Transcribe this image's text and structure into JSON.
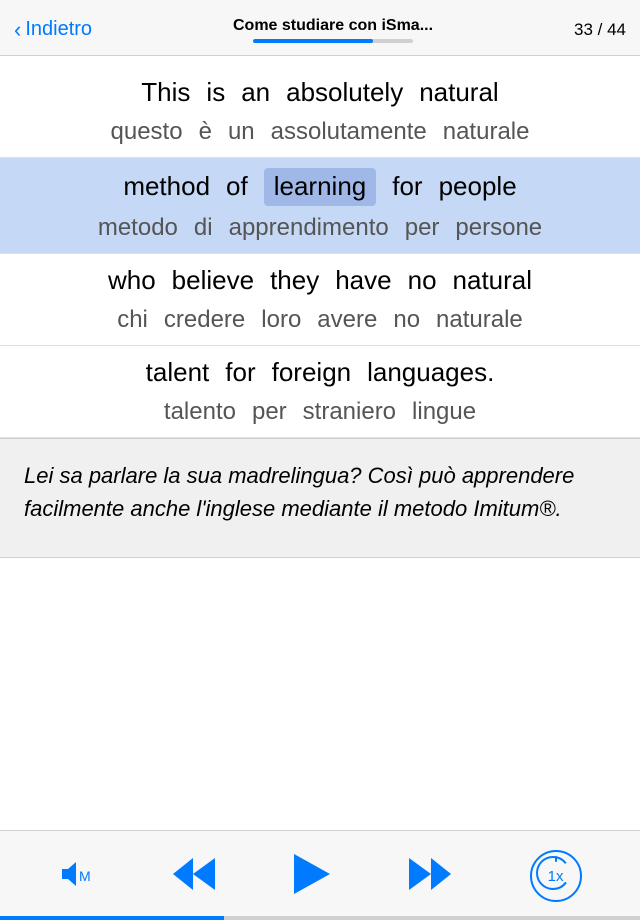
{
  "header": {
    "back_label": "Indietro",
    "title": "Come studiare con iSma...",
    "page_current": "33",
    "page_total": "44",
    "page_display": "33 / 44",
    "progress_percent": 75
  },
  "content": {
    "rows": [
      {
        "id": "row1",
        "highlighted": false,
        "english_words": [
          "This",
          "is",
          "an",
          "absolutely",
          "natural"
        ],
        "italian_words": [
          "questo",
          "è",
          "un",
          "assolutamente",
          "naturale"
        ],
        "highlight_english": [],
        "highlight_italian": []
      },
      {
        "id": "row2",
        "highlighted": true,
        "english_words": [
          "method",
          "of",
          "learning",
          "for",
          "people"
        ],
        "italian_words": [
          "metodo",
          "di",
          "apprendimento",
          "per",
          "persone"
        ],
        "highlight_english": [
          "learning"
        ],
        "highlight_italian": []
      },
      {
        "id": "row3",
        "highlighted": false,
        "english_words": [
          "who",
          "believe",
          "they",
          "have",
          "no",
          "natural"
        ],
        "italian_words": [
          "chi",
          "credere",
          "loro",
          "avere",
          "no",
          "naturale"
        ],
        "highlight_english": [],
        "highlight_italian": []
      },
      {
        "id": "row4",
        "highlighted": false,
        "english_words": [
          "talent",
          "for",
          "foreign",
          "languages."
        ],
        "italian_words": [
          "talento",
          "per",
          "straniero",
          "lingue"
        ],
        "highlight_english": [],
        "highlight_italian": []
      }
    ]
  },
  "description": {
    "text": "Lei sa parlare la sua madrelingua? Così può apprendere facilmente anche l'inglese mediante il metodo Imitum®."
  },
  "controls": {
    "volume_label": "M",
    "speed_label": "1x",
    "speed_icon": "clock"
  },
  "bottom_progress_percent": 35
}
